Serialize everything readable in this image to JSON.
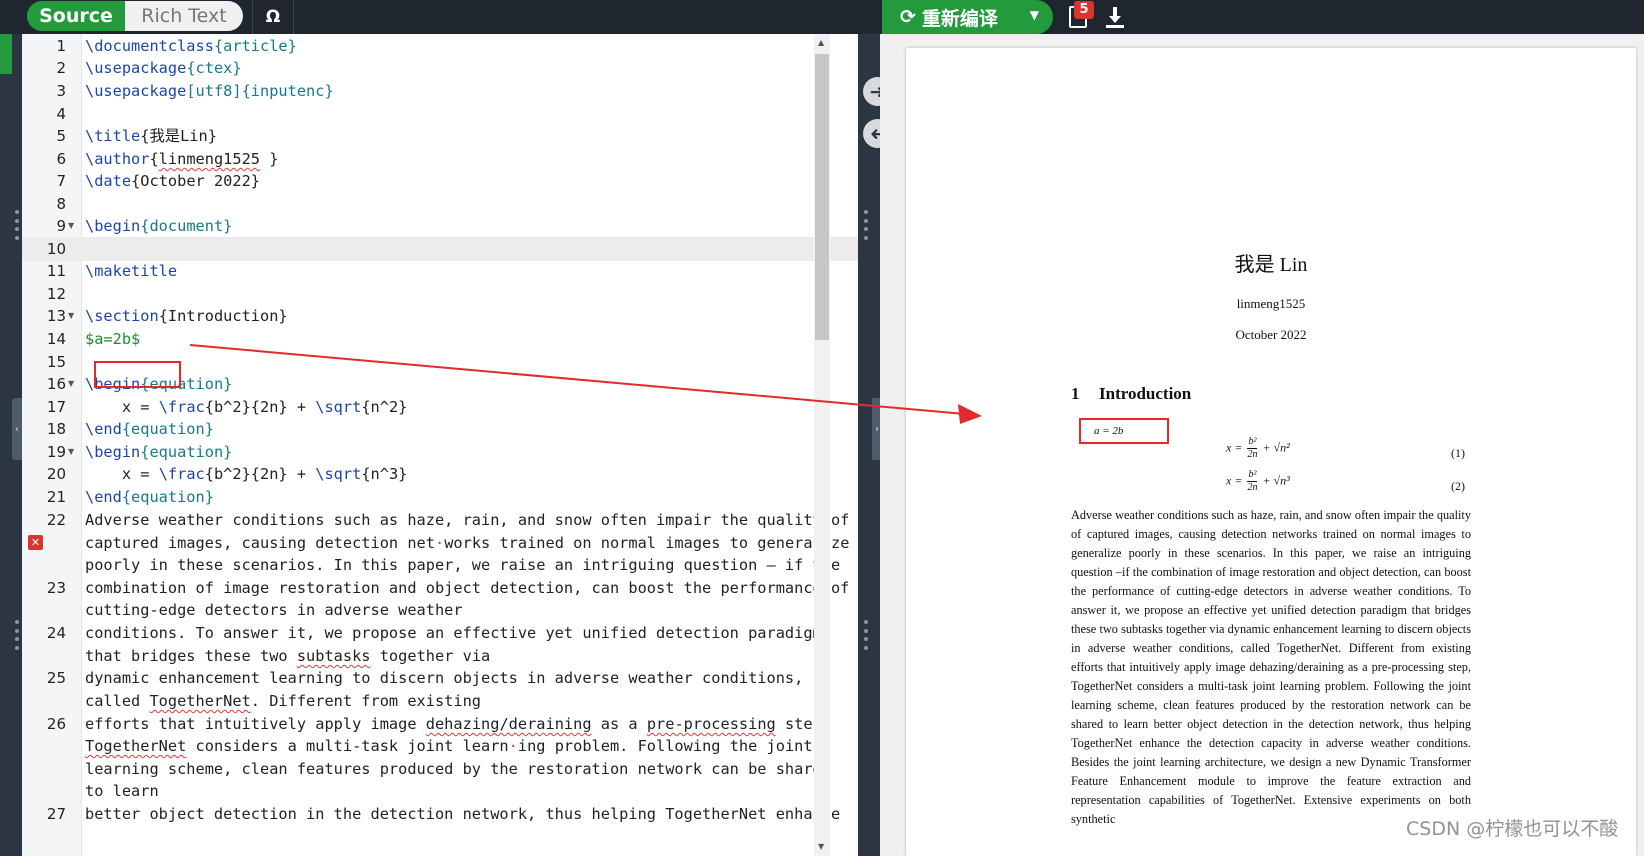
{
  "toolbar": {
    "mode_source": "Source",
    "mode_rich": "Rich Text",
    "omega": "Ω",
    "recompile": "重新编译",
    "log_badge_count": "5"
  },
  "editor": {
    "active_line": 10,
    "lines": [
      {
        "num": "1",
        "fold": false
      },
      {
        "num": "2",
        "fold": false
      },
      {
        "num": "3",
        "fold": false
      },
      {
        "num": "4",
        "fold": false
      },
      {
        "num": "5",
        "fold": false
      },
      {
        "num": "6",
        "fold": false
      },
      {
        "num": "7",
        "fold": false
      },
      {
        "num": "8",
        "fold": false
      },
      {
        "num": "9",
        "fold": true
      },
      {
        "num": "10",
        "fold": false
      },
      {
        "num": "11",
        "fold": false
      },
      {
        "num": "12",
        "fold": false
      },
      {
        "num": "13",
        "fold": true
      },
      {
        "num": "14",
        "fold": false
      },
      {
        "num": "15",
        "fold": false
      },
      {
        "num": "16",
        "fold": true
      },
      {
        "num": "17",
        "fold": false
      },
      {
        "num": "18",
        "fold": false
      },
      {
        "num": "19",
        "fold": true
      },
      {
        "num": "20",
        "fold": false
      },
      {
        "num": "21",
        "fold": false
      },
      {
        "num": "22",
        "fold": false
      },
      {
        "num": "23",
        "fold": false
      },
      {
        "num": "24",
        "fold": false
      },
      {
        "num": "25",
        "fold": false
      },
      {
        "num": "26",
        "fold": false
      },
      {
        "num": "27",
        "fold": false
      }
    ],
    "code": {
      "l1a": "\\documentclass",
      "l1b": "{article}",
      "l2a": "\\usepackage",
      "l2b": "{ctex}",
      "l3a": "\\usepackage",
      "l3b": "[utf8]",
      "l3c": "{inputenc}",
      "l5a": "\\title",
      "l5b": "{我是Lin}",
      "l6a": "\\author",
      "l6b": "{",
      "l6c": "linmeng1525",
      "l6d": " }",
      "l7a": "\\date",
      "l7b": "{October 2022}",
      "l9a": "\\begin",
      "l9b": "{document}",
      "l11a": "\\maketitle",
      "l13a": "\\section",
      "l13b": "{Introduction}",
      "l14a": "$a=2b$",
      "l16a": "\\begin",
      "l16b": "{equation}",
      "l17a": "    x = ",
      "l17b": "\\frac",
      "l17c": "{b^2}{2n} + ",
      "l17d": "\\sqrt",
      "l17e": "{n^2}",
      "l18a": "\\end",
      "l18b": "{equation}",
      "l19a": "\\begin",
      "l19b": "{equation}",
      "l20a": "    x = ",
      "l20b": "\\frac",
      "l20c": "{b^2}{2n} + ",
      "l20d": "\\sqrt",
      "l20e": "{n^3}",
      "l21a": "\\end",
      "l21b": "{equation}",
      "w1": "Adverse weather conditions such as haze, rain, and snow often impair the quality of",
      "w2a": "captured images, causing detection net",
      "w2b": "·",
      "w2c": "works trained on normal images to generalize",
      "w3": "poorly in these scenarios. In this paper, we raise an intriguing question – if the",
      "w4": "combination of image restoration and object detection, can boost the performance of",
      "w5": "cutting-edge detectors in adverse weather",
      "w6": "conditions. To answer it, we propose an effective yet unified detection paradigm",
      "w7a": "that bridges these two ",
      "w7b": "subtasks",
      "w7c": " together via",
      "w8": "dynamic enhancement learning to discern objects in adverse weather conditions,",
      "w9a": "called ",
      "w9b": "TogetherNet",
      "w9c": ". Different from existing",
      "w10a": "efforts that intuitively apply image ",
      "w10b": "dehazing/deraining",
      "w10c": " as a ",
      "w10d": "pre-processing",
      "w10e": " step,",
      "w11a": "TogetherNet",
      "w11b": " considers a multi-task joint learn",
      "w11c": "·",
      "w11d": "ing problem. Following the joint",
      "w12": "learning scheme, clean features produced by the restoration network can be shared",
      "w13": "to learn",
      "w14": "better object detection in the detection network, thus helping TogetherNet enhance"
    }
  },
  "pdf": {
    "title": "我是 Lin",
    "author": "linmeng1525",
    "date": "October 2022",
    "section_number": "1",
    "section_title": "Introduction",
    "inline_math": "a = 2b",
    "eq1": {
      "lhs": "x =",
      "num": "b²",
      "den": "2n",
      "rest": "+ √n²",
      "label": "(1)"
    },
    "eq2": {
      "lhs": "x =",
      "num": "b²",
      "den": "2n",
      "rest": "+ √n³",
      "label": "(2)"
    },
    "paragraph": "Adverse weather conditions such as haze, rain, and snow often impair the quality of captured images, causing detection networks trained on normal images to generalize poorly in these scenarios. In this paper, we raise an intriguing question –if the combination of image restoration and object detection, can boost the performance of cutting-edge detectors in adverse weather conditions. To answer it, we propose an effective yet unified detection paradigm that bridges these two subtasks together via dynamic enhancement learning to discern objects in adverse weather conditions, called TogetherNet. Different from existing efforts that intuitively apply image dehazing/deraining as a pre-processing step, TogetherNet considers a multi-task joint learning problem. Following the joint learning scheme, clean features produced by the restoration network can be shared to learn better object detection in the detection network, thus helping TogetherNet enhance the detection capacity in adverse weather conditions. Besides the joint learning architecture, we design a new Dynamic Transformer Feature Enhancement module to improve the feature extraction and representation capabilities of TogetherNet. Extensive experiments on both synthetic"
  },
  "watermark": "CSDN @柠檬也可以不酸",
  "colors": {
    "accent_green": "#239b3c",
    "highlight_red": "#e32a2a",
    "toolbar_bg": "#1f262f"
  }
}
